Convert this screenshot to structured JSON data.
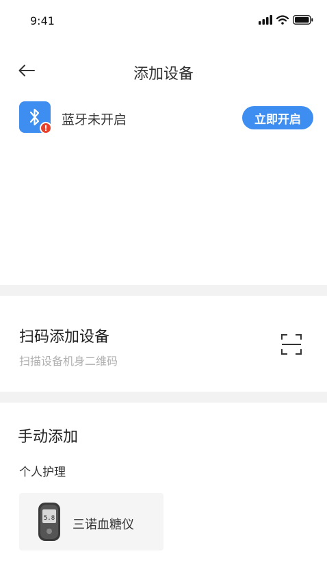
{
  "status_bar": {
    "time": "9:41",
    "icons": [
      "signal-icon",
      "wifi-icon",
      "battery-icon"
    ]
  },
  "nav": {
    "title": "添加设备",
    "back_icon": "arrow-left-icon"
  },
  "bluetooth": {
    "icon": "bluetooth-icon",
    "alert_mark": "!",
    "status_text": "蓝牙未开启",
    "open_label": "立即开启"
  },
  "scan": {
    "title": "扫码添加设备",
    "subtitle": "扫描设备机身二维码",
    "icon": "scan-icon"
  },
  "manual": {
    "title": "手动添加",
    "categories": [
      {
        "label": "个人护理",
        "devices": [
          {
            "name": "三诺血糖仪",
            "icon": "glucose-meter-icon",
            "screen_value": "5.8"
          }
        ]
      }
    ]
  },
  "colors": {
    "accent": "#3d8ef0",
    "alert": "#e8412c",
    "divider": "#f2f2f2",
    "subtitle_text": "#b0b0b0"
  }
}
